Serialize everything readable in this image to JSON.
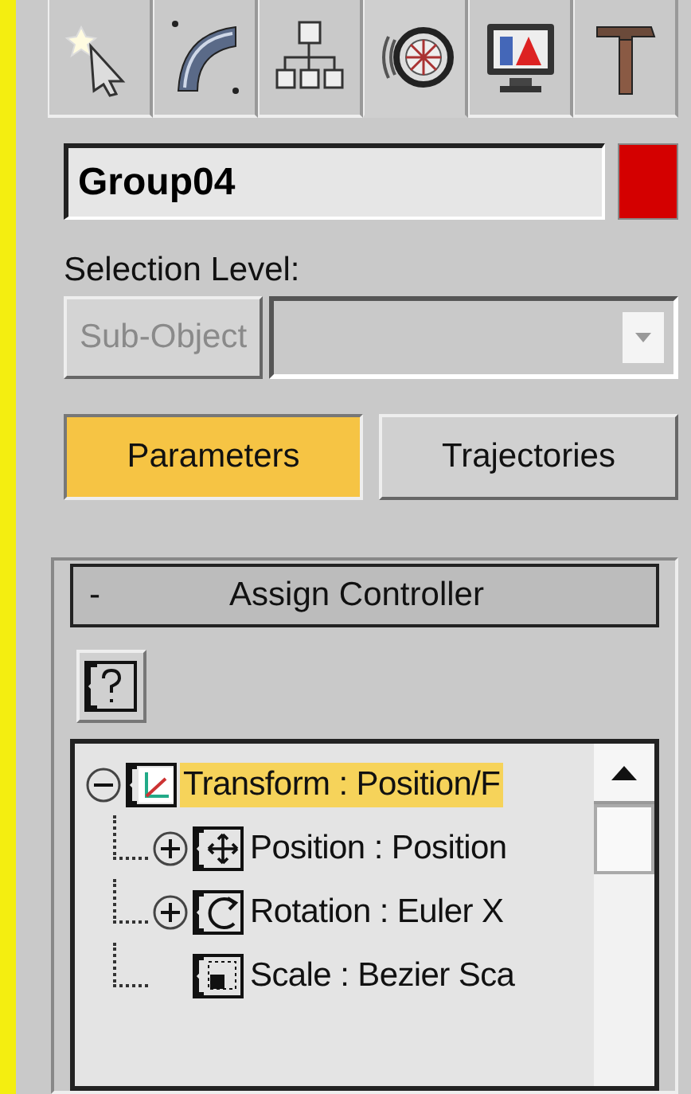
{
  "tabs": [
    {
      "kind": "create",
      "selected": false
    },
    {
      "kind": "modify",
      "selected": false
    },
    {
      "kind": "hierarchy",
      "selected": false
    },
    {
      "kind": "motion",
      "selected": true
    },
    {
      "kind": "display",
      "selected": false
    },
    {
      "kind": "utilities",
      "selected": false
    }
  ],
  "object": {
    "value": "Group04",
    "color": "#d40000"
  },
  "selection_level": {
    "label": "Selection Level:",
    "button": {
      "label": "Sub-Object",
      "disabled": true
    }
  },
  "mode_buttons": [
    {
      "label": "Parameters",
      "selected": true
    },
    {
      "label": "Trajectories",
      "selected": false
    }
  ],
  "rollout": {
    "title": "Assign Controller",
    "toggle": "-",
    "tree": [
      {
        "kind": "transform",
        "label": "Transform : Position/F",
        "selected": true,
        "expanded": true,
        "children": [
          {
            "kind": "position",
            "label": "Position : Position",
            "selected": false,
            "expanded": false,
            "has_children": true
          },
          {
            "kind": "rotation",
            "label": "Rotation : Euler X",
            "selected": false,
            "expanded": false,
            "has_children": true
          },
          {
            "kind": "scale",
            "label": "Scale : Bezier Sca",
            "selected": false,
            "expanded": false,
            "has_children": false
          }
        ]
      }
    ]
  }
}
